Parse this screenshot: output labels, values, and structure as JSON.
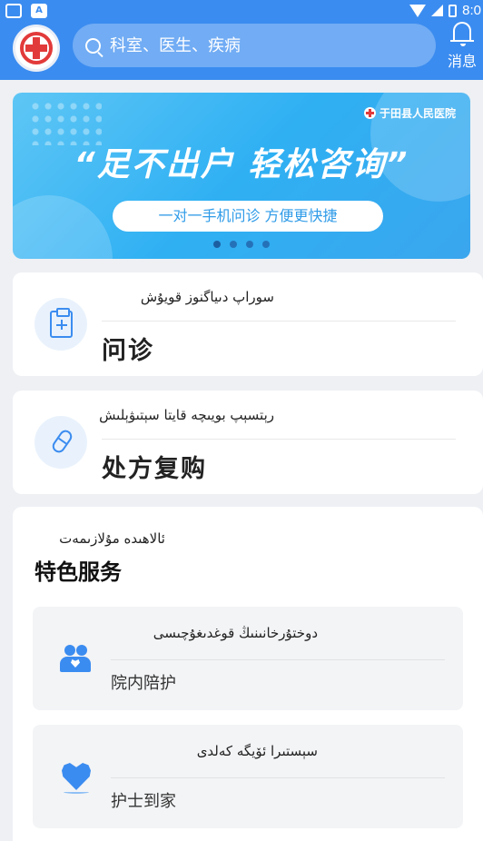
{
  "status_bar": {
    "time": "8:0",
    "left_icons": [
      "mail-icon",
      "a-icon"
    ],
    "right_icons": [
      "wifi-icon",
      "signal-icon",
      "battery-icon"
    ],
    "left_b_letter": "A"
  },
  "header": {
    "logo_icon": "hospital-cross-icon",
    "search": {
      "placeholder": "科室、医生、疾病",
      "icon": "search-icon"
    },
    "messages": {
      "label": "消息",
      "icon": "bell-icon"
    }
  },
  "banner": {
    "hospital_name": "于田县人民医院",
    "slogan": "“足不出户 轻松咨询”",
    "subtitle": "一对一手机问诊  方便更快捷",
    "page_count": 4,
    "active_page": 1
  },
  "services": [
    {
      "icon": "clipboard-plus-icon",
      "uyghur": "سوراپ دىياگنوز قويۇش",
      "title": "问诊"
    },
    {
      "icon": "pill-icon",
      "uyghur": "رېتسېپ بويىچە قايتا سېتىۋېلىش",
      "title": "处方复购"
    }
  ],
  "special": {
    "uyghur": "ئالاھىدە مۇلازىمەت",
    "title": "特色服务",
    "items": [
      {
        "icon": "people-heart-icon",
        "uyghur": "دوختۇرخانىنىڭ قوغدىغۇچىسى",
        "title": "院内陪护"
      },
      {
        "icon": "heart-hand-icon",
        "uyghur": "سېستىرا ئۆيگە كەلدى",
        "title": "护士到家"
      }
    ]
  },
  "colors": {
    "brand": "#3b8cf0",
    "banner": "#2fb0f3",
    "logo_red": "#e23a3a",
    "background": "#eef0f4"
  }
}
